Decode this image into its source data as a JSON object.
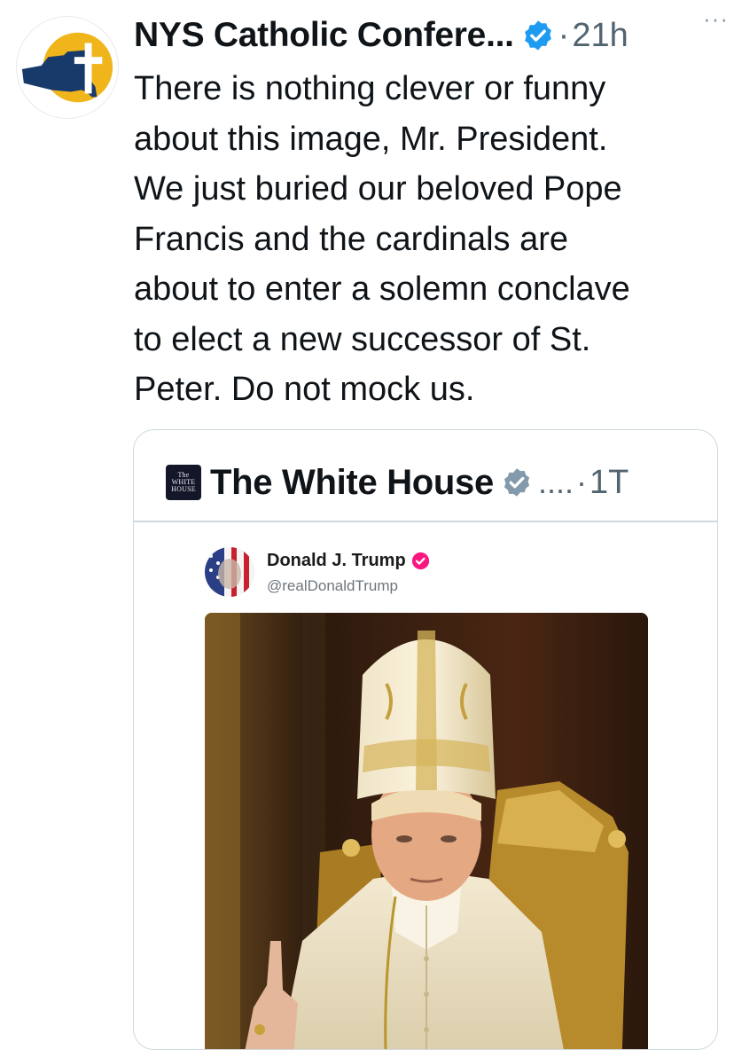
{
  "author": {
    "name": "NYS Catholic Confere...",
    "time": "21h",
    "dot": "·",
    "more": "···",
    "avatar_icon": "nys-catholic-conference-logo",
    "verified_color": "#1d9bf0"
  },
  "tweet": {
    "lines": [
      "There is nothing clever or funny",
      "about this image, Mr. President.",
      "We just buried our beloved Pope",
      "Francis and the cardinals are",
      "about to enter a solemn conclave",
      "to elect a new successor of St.",
      "Peter. Do not mock us."
    ]
  },
  "quote": {
    "name": "The White House",
    "logo_text": [
      "The",
      "WHITE",
      "HOUSE"
    ],
    "ellipsis": "....",
    "dot": "·",
    "time": "1T",
    "verified_color": "#829aab",
    "embedded": {
      "name": "Donald J. Trump",
      "handle": "@realDonaldTrump",
      "verified_color": "#f91880",
      "image": "ai-generated-figure-in-papal-vestments-and-mitre"
    }
  },
  "colors": {
    "text": "#0f1419",
    "secondary": "#536471",
    "border": "#cfd9de",
    "logo_gold": "#f1b51c",
    "logo_navy": "#173a6b"
  }
}
